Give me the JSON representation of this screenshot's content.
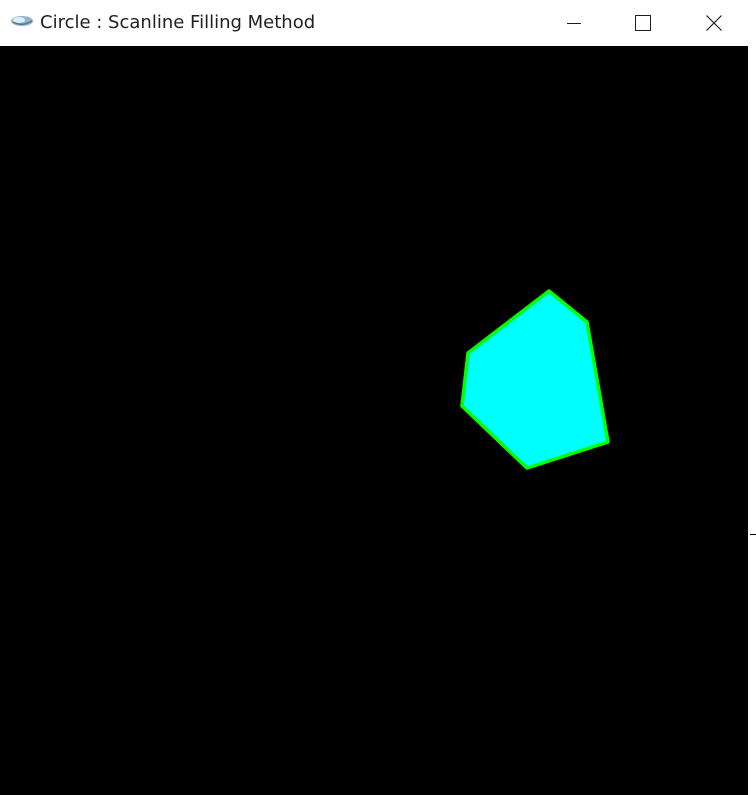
{
  "window": {
    "title": "Circle : Scanline Filling Method",
    "app_icon": "glut-app-icon",
    "controls": {
      "minimize": "minimize-icon",
      "maximize": "maximize-icon",
      "close": "close-icon"
    }
  },
  "canvas": {
    "background_color": "#000000",
    "polygon": {
      "fill_color": "#00ffff",
      "outline_color": "#00ff00"
    }
  }
}
